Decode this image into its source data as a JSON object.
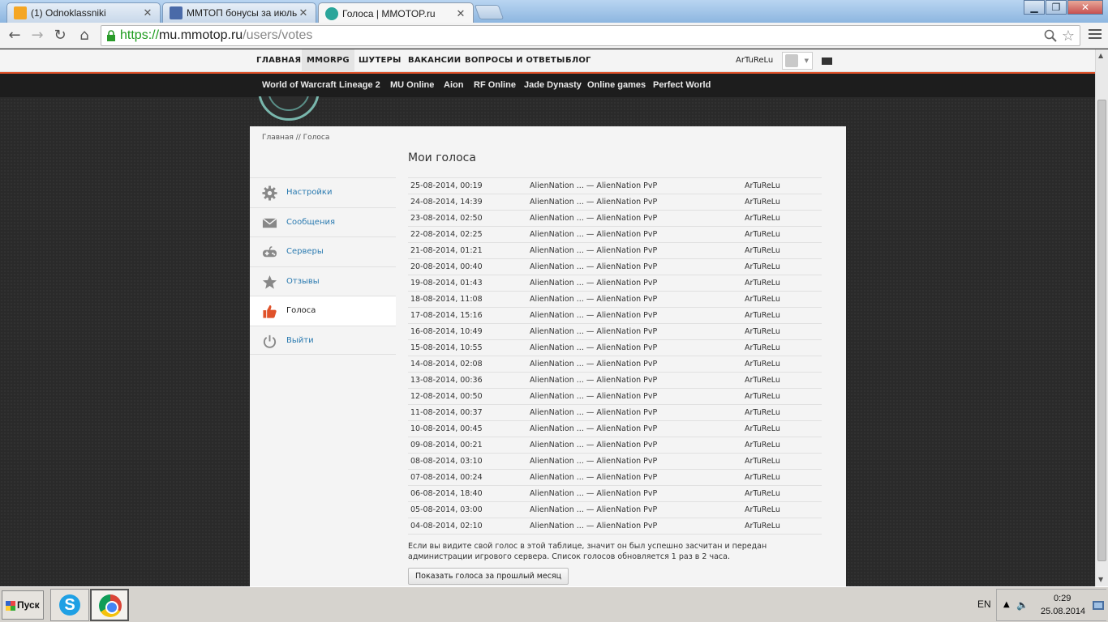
{
  "browser": {
    "tabs": [
      {
        "title": "(1) Odnoklassniki",
        "close": "✕",
        "favicon_color": "#f5a623"
      },
      {
        "title": "ММТОП бонусы за июль - А",
        "close": "✕",
        "favicon_color": "#4a6aa8"
      },
      {
        "title": "Голоса | MMOTOP.ru",
        "close": "✕",
        "favicon_color": "#2aa59a"
      }
    ],
    "url": {
      "scheme": "https://",
      "host": "mu.mmotop.ru",
      "path": "/users/votes"
    },
    "window_buttons": [
      "▁",
      "❐",
      "✕"
    ]
  },
  "site": {
    "topnav": [
      "ГЛАВНАЯ",
      "MMORPG",
      "ШУТЕРЫ",
      "ВАКАНСИИ",
      "ВОПРОСЫ И ОТВЕТЫ",
      "БЛОГ"
    ],
    "username": "ArTuReLu",
    "subnav": [
      "World of Warcraft",
      "Lineage 2",
      "MU Online",
      "Aion",
      "RF Online",
      "Jade Dynasty",
      "Online games",
      "Perfect World"
    ],
    "breadcrumb": "Главная // Голоса",
    "page_title": "Мои голоса",
    "sidemenu": [
      {
        "label": "Настройки",
        "icon": "gear-icon"
      },
      {
        "label": "Сообщения",
        "icon": "envelope-icon"
      },
      {
        "label": "Серверы",
        "icon": "gamepad-icon"
      },
      {
        "label": "Отзывы",
        "icon": "star-icon"
      },
      {
        "label": "Голоса",
        "icon": "thumbs-up-icon"
      },
      {
        "label": "Выйти",
        "icon": "power-icon"
      }
    ],
    "votes": [
      {
        "date": "25-08-2014, 00:19",
        "server": "AlienNation ... — AlienNation PvP",
        "user": "ArTuReLu"
      },
      {
        "date": "24-08-2014, 14:39",
        "server": "AlienNation ... — AlienNation PvP",
        "user": "ArTuReLu"
      },
      {
        "date": "23-08-2014, 02:50",
        "server": "AlienNation ... — AlienNation PvP",
        "user": "ArTuReLu"
      },
      {
        "date": "22-08-2014, 02:25",
        "server": "AlienNation ... — AlienNation PvP",
        "user": "ArTuReLu"
      },
      {
        "date": "21-08-2014, 01:21",
        "server": "AlienNation ... — AlienNation PvP",
        "user": "ArTuReLu"
      },
      {
        "date": "20-08-2014, 00:40",
        "server": "AlienNation ... — AlienNation PvP",
        "user": "ArTuReLu"
      },
      {
        "date": "19-08-2014, 01:43",
        "server": "AlienNation ... — AlienNation PvP",
        "user": "ArTuReLu"
      },
      {
        "date": "18-08-2014, 11:08",
        "server": "AlienNation ... — AlienNation PvP",
        "user": "ArTuReLu"
      },
      {
        "date": "17-08-2014, 15:16",
        "server": "AlienNation ... — AlienNation PvP",
        "user": "ArTuReLu"
      },
      {
        "date": "16-08-2014, 10:49",
        "server": "AlienNation ... — AlienNation PvP",
        "user": "ArTuReLu"
      },
      {
        "date": "15-08-2014, 10:55",
        "server": "AlienNation ... — AlienNation PvP",
        "user": "ArTuReLu"
      },
      {
        "date": "14-08-2014, 02:08",
        "server": "AlienNation ... — AlienNation PvP",
        "user": "ArTuReLu"
      },
      {
        "date": "13-08-2014, 00:36",
        "server": "AlienNation ... — AlienNation PvP",
        "user": "ArTuReLu"
      },
      {
        "date": "12-08-2014, 00:50",
        "server": "AlienNation ... — AlienNation PvP",
        "user": "ArTuReLu"
      },
      {
        "date": "11-08-2014, 00:37",
        "server": "AlienNation ... — AlienNation PvP",
        "user": "ArTuReLu"
      },
      {
        "date": "10-08-2014, 00:45",
        "server": "AlienNation ... — AlienNation PvP",
        "user": "ArTuReLu"
      },
      {
        "date": "09-08-2014, 00:21",
        "server": "AlienNation ... — AlienNation PvP",
        "user": "ArTuReLu"
      },
      {
        "date": "08-08-2014, 03:10",
        "server": "AlienNation ... — AlienNation PvP",
        "user": "ArTuReLu"
      },
      {
        "date": "07-08-2014, 00:24",
        "server": "AlienNation ... — AlienNation PvP",
        "user": "ArTuReLu"
      },
      {
        "date": "06-08-2014, 18:40",
        "server": "AlienNation ... — AlienNation PvP",
        "user": "ArTuReLu"
      },
      {
        "date": "05-08-2014, 03:00",
        "server": "AlienNation ... — AlienNation PvP",
        "user": "ArTuReLu"
      },
      {
        "date": "04-08-2014, 02:10",
        "server": "AlienNation ... — AlienNation PvP",
        "user": "ArTuReLu"
      }
    ],
    "note": "Если вы видите свой голос в этой таблице, значит он был успешно засчитан и передан администрации игрового сервера. Список голосов обновляется 1 раз в 2 часа.",
    "prev_month_button": "Показать голоса за прошлый месяц",
    "accent_color": "#e0522a",
    "link_color": "#2a7ab0"
  },
  "taskbar": {
    "start": "Пуск",
    "lang": "EN",
    "time": "0:29",
    "date": "25.08.2014"
  }
}
